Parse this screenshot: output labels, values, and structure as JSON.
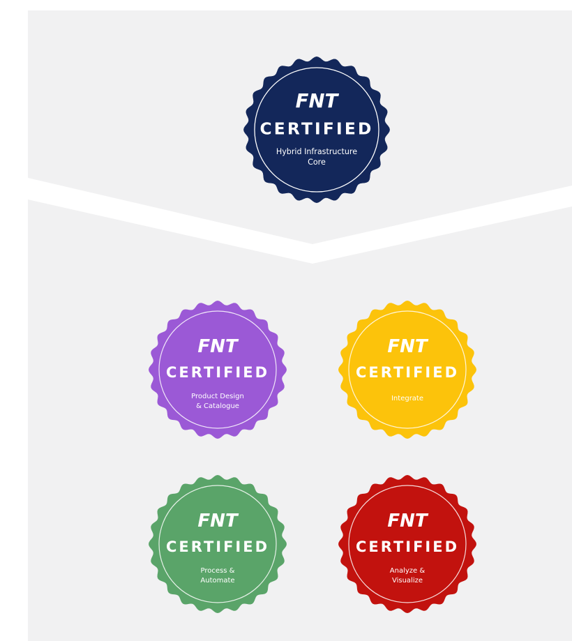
{
  "colors": {
    "page_background": "#ffffff",
    "panel_background": "#f1f1f2",
    "core_badge": "#13275a",
    "purple_badge": "#9b59d6",
    "yellow_badge": "#fcc30b",
    "green_badge": "#5aa469",
    "red_badge": "#c2120e",
    "badge_text": "#ffffff"
  },
  "badges": {
    "core": {
      "brand": "FNT",
      "certified": "CERTIFIED",
      "line1": "Hybrid Infrastructure",
      "line2": "Core",
      "icon": "certification-seal-icon"
    },
    "product_design": {
      "brand": "FNT",
      "certified": "CERTIFIED",
      "line1": "Product Design",
      "line2": "& Catalogue",
      "icon": "certification-seal-icon"
    },
    "integrate": {
      "brand": "FNT",
      "certified": "CERTIFIED",
      "line1": "Integrate",
      "line2": "",
      "icon": "certification-seal-icon"
    },
    "process": {
      "brand": "FNT",
      "certified": "CERTIFIED",
      "line1": "Process &",
      "line2": "Automate",
      "icon": "certification-seal-icon"
    },
    "analyze": {
      "brand": "FNT",
      "certified": "CERTIFIED",
      "line1": "Analyze &",
      "line2": "Visualize",
      "icon": "certification-seal-icon"
    }
  }
}
